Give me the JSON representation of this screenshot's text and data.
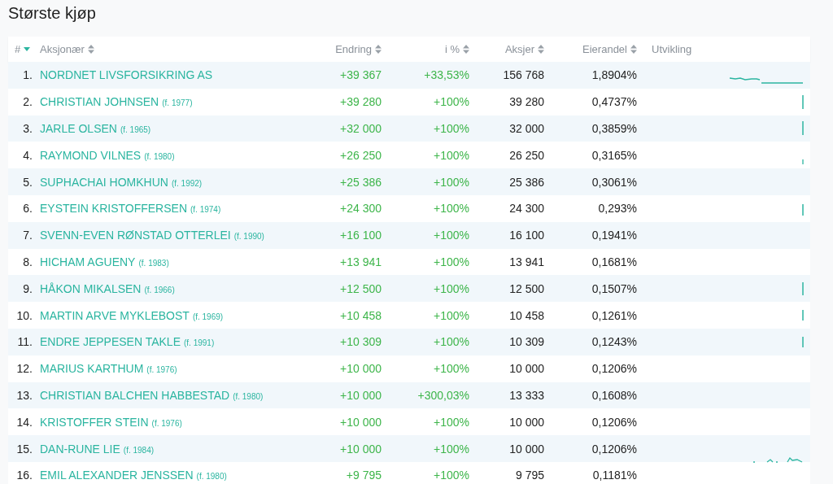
{
  "title": "Største kjøp",
  "table": {
    "columns": [
      {
        "label": "#",
        "sortable": true,
        "sorted": true
      },
      {
        "label": "Aksjonær",
        "sortable": true,
        "sorted": false
      },
      {
        "label": "Endring",
        "sortable": true,
        "sorted": false
      },
      {
        "label": "i %",
        "sortable": true,
        "sorted": false
      },
      {
        "label": "Aksjer",
        "sortable": true,
        "sorted": false
      },
      {
        "label": "Eierandel",
        "sortable": true,
        "sorted": false
      },
      {
        "label": "Utvikling"
      }
    ],
    "rows": [
      {
        "rank": "1.",
        "name": "NORDNET LIVSFORSIKRING AS",
        "change": "+39 367",
        "pct": "+33,53%",
        "shares": "156 768",
        "stake": "1,8904%"
      },
      {
        "rank": "2.",
        "name": "CHRISTIAN JOHNSEN",
        "born": "(f. 1977)",
        "change": "+39 280",
        "pct": "+100%",
        "shares": "39 280",
        "stake": "0,4737%"
      },
      {
        "rank": "3.",
        "name": "JARLE OLSEN",
        "born": "(f. 1965)",
        "change": "+32 000",
        "pct": "+100%",
        "shares": "32 000",
        "stake": "0,3859%"
      },
      {
        "rank": "4.",
        "name": "RAYMOND VILNES",
        "born": "(f. 1980)",
        "change": "+26 250",
        "pct": "+100%",
        "shares": "26 250",
        "stake": "0,3165%"
      },
      {
        "rank": "5.",
        "name": "SUPHACHAI HOMKHUN",
        "born": "(f. 1992)",
        "change": "+25 386",
        "pct": "+100%",
        "shares": "25 386",
        "stake": "0,3061%"
      },
      {
        "rank": "6.",
        "name": "EYSTEIN KRISTOFFERSEN",
        "born": "(f. 1974)",
        "change": "+24 300",
        "pct": "+100%",
        "shares": "24 300",
        "stake": "0,293%"
      },
      {
        "rank": "7.",
        "name": "SVENN-EVEN RØNSTAD OTTERLEI",
        "born": "(f. 1990)",
        "change": "+16 100",
        "pct": "+100%",
        "shares": "16 100",
        "stake": "0,1941%"
      },
      {
        "rank": "8.",
        "name": "HICHAM AGUENY",
        "born": "(f. 1983)",
        "change": "+13 941",
        "pct": "+100%",
        "shares": "13 941",
        "stake": "0,1681%"
      },
      {
        "rank": "9.",
        "name": "HÅKON MIKALSEN",
        "born": "(f. 1966)",
        "change": "+12 500",
        "pct": "+100%",
        "shares": "12 500",
        "stake": "0,1507%"
      },
      {
        "rank": "10.",
        "name": "MARTIN ARVE MYKLEBOST",
        "born": "(f. 1969)",
        "change": "+10 458",
        "pct": "+100%",
        "shares": "10 458",
        "stake": "0,1261%"
      },
      {
        "rank": "11.",
        "name": "ENDRE JEPPESEN TAKLE",
        "born": "(f. 1991)",
        "change": "+10 309",
        "pct": "+100%",
        "shares": "10 309",
        "stake": "0,1243%"
      },
      {
        "rank": "12.",
        "name": "MARIUS KARTHUM",
        "born": "(f. 1976)",
        "change": "+10 000",
        "pct": "+100%",
        "shares": "10 000",
        "stake": "0,1206%"
      },
      {
        "rank": "13.",
        "name": "CHRISTIAN BALCHEN HABBESTAD",
        "born": "(f. 1980)",
        "change": "+10 000",
        "pct": "+300,03%",
        "shares": "13 333",
        "stake": "0,1608%"
      },
      {
        "rank": "14.",
        "name": "KRISTOFFER STEIN",
        "born": "(f. 1976)",
        "change": "+10 000",
        "pct": "+100%",
        "shares": "10 000",
        "stake": "0,1206%"
      },
      {
        "rank": "15.",
        "name": "DAN-RUNE LIE",
        "born": "(f. 1984)",
        "change": "+10 000",
        "pct": "+100%",
        "shares": "10 000",
        "stake": "0,1206%"
      },
      {
        "rank": "16.",
        "name": "EMIL ALEXANDER JENSSEN",
        "born": "(f. 1980)",
        "change": "+9 795",
        "pct": "+100%",
        "shares": "9 795",
        "stake": "0,1181%"
      }
    ]
  }
}
